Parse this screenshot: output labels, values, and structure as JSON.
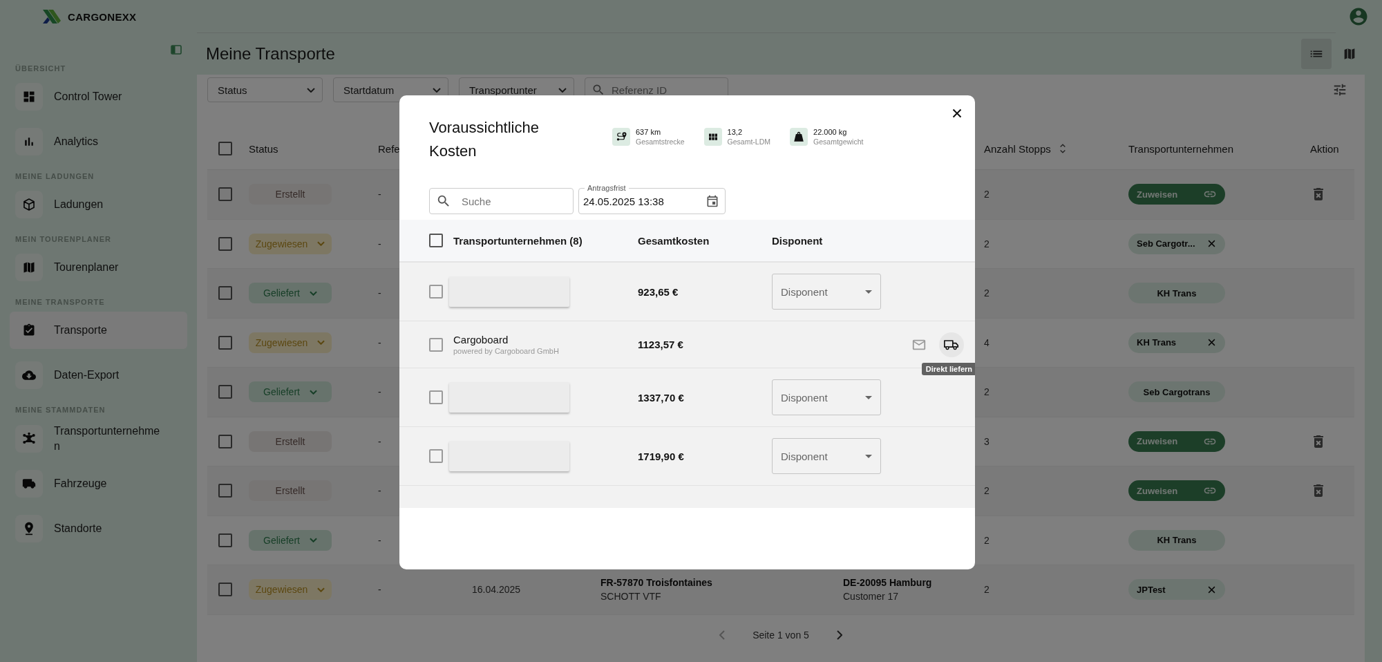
{
  "topbar": {
    "brand": "CARGONEXX"
  },
  "sidebar": {
    "sections": [
      {
        "heading": "ÜBERSICHT",
        "items": [
          {
            "label": "Control Tower",
            "selected": false
          },
          {
            "label": "Analytics",
            "selected": false
          }
        ]
      },
      {
        "heading": "MEINE LADUNGEN",
        "items": [
          {
            "label": "Ladungen",
            "selected": false
          }
        ]
      },
      {
        "heading": "MEIN TOURENPLANER",
        "items": [
          {
            "label": "Tourenplaner",
            "selected": false
          }
        ]
      },
      {
        "heading": "MEINE TRANSPORTE",
        "items": [
          {
            "label": "Transporte",
            "selected": true
          },
          {
            "label": "Daten-Export",
            "selected": false
          }
        ]
      },
      {
        "heading": "MEINE STAMMDATEN",
        "items": [
          {
            "label": "Transportunternehmen",
            "selected": false
          },
          {
            "label": "Fahrzeuge",
            "selected": false
          },
          {
            "label": "Standorte",
            "selected": false
          }
        ]
      }
    ]
  },
  "page": {
    "title": "Meine Transporte",
    "views": [
      {
        "selected": true
      },
      {
        "selected": false
      }
    ]
  },
  "filters": [
    {
      "kind": "select",
      "label": "Status"
    },
    {
      "kind": "select",
      "label": "Startdatum"
    },
    {
      "kind": "select",
      "label": "Transportunter"
    },
    {
      "kind": "search",
      "placeholder": "Referenz ID"
    }
  ],
  "table": {
    "all_selected": false,
    "columns": [
      {
        "label": "Status"
      },
      {
        "label": "Refe"
      },
      {
        "label": "Anzahl Stopps",
        "sortable": true
      },
      {
        "label": "Transportunternehmen"
      },
      {
        "label": "Aktion"
      }
    ],
    "rows": [
      {
        "selected": false,
        "status": {
          "kind": "created",
          "label": "Erstellt"
        },
        "reference": "-",
        "stops": "2",
        "carrier": {
          "kind": "assign",
          "label": "Zuweisen"
        },
        "deletable": true
      },
      {
        "selected": false,
        "status": {
          "kind": "assigned",
          "label": "Zugewiesen"
        },
        "reference": "-",
        "stops": "2",
        "carrier": {
          "kind": "removable",
          "label": "Seb Cargotr..."
        },
        "deletable": false
      },
      {
        "selected": false,
        "status": {
          "kind": "delivered",
          "label": "Geliefert"
        },
        "reference": "-",
        "stops": "2",
        "carrier": {
          "kind": "fixed",
          "label": "KH Trans"
        },
        "deletable": false
      },
      {
        "selected": false,
        "status": {
          "kind": "assigned",
          "label": "Zugewiesen"
        },
        "reference": "-",
        "stops": "4",
        "carrier": {
          "kind": "removable",
          "label": "KH Trans"
        },
        "deletable": false
      },
      {
        "selected": false,
        "status": {
          "kind": "delivered",
          "label": "Geliefert"
        },
        "reference": "-",
        "stops": "2",
        "carrier": {
          "kind": "fixed",
          "label": "Seb Cargotrans"
        },
        "deletable": false
      },
      {
        "selected": false,
        "status": {
          "kind": "created",
          "label": "Erstellt"
        },
        "reference": "-",
        "stops": "3",
        "carrier": {
          "kind": "assign",
          "label": "Zuweisen"
        },
        "deletable": true
      },
      {
        "selected": false,
        "status": {
          "kind": "created",
          "label": "Erstellt"
        },
        "reference": "-",
        "stops": "2",
        "carrier": {
          "kind": "assign",
          "label": "Zuweisen"
        },
        "deletable": true
      },
      {
        "selected": false,
        "status": {
          "kind": "delivered",
          "label": "Geliefert"
        },
        "reference": "-",
        "stops": "2",
        "carrier": {
          "kind": "fixed",
          "label": "KH Trans"
        },
        "deletable": false
      },
      {
        "selected": false,
        "status": {
          "kind": "assigned",
          "label": "Zugewiesen"
        },
        "reference": "-",
        "start_date": "16.04.2025",
        "from": {
          "place": "FR-57870 Troisfontaines",
          "name": "SCHOTT VTF"
        },
        "to": {
          "place": "DE-20095 Hamburg",
          "name": "Customer 17"
        },
        "stops": "2",
        "carrier": {
          "kind": "removable",
          "label": "JPTest"
        },
        "deletable": false
      }
    ]
  },
  "pagination": {
    "label": "Seite 1 von 5",
    "prev_disabled": true,
    "next_disabled": false
  },
  "modal": {
    "title": "Voraussichtliche Kosten",
    "stats": [
      {
        "value": "637 km",
        "label": "Gesamtstrecke"
      },
      {
        "value": "13,2",
        "label": "Gesamt-LDM"
      },
      {
        "value": "22.000 kg",
        "label": "Gesamtgewicht"
      }
    ],
    "search": {
      "placeholder": "Suche"
    },
    "deadline": {
      "label": "Antragsfrist",
      "value": "24.05.2025 13:38"
    },
    "all_selected": false,
    "columns": [
      "Transportunternehmen (8)",
      "Gesamtkosten",
      "Disponent"
    ],
    "rows": [
      {
        "kind": "dropdown",
        "selected": false,
        "cost": "923,65 €",
        "dispatcher_placeholder": "Disponent"
      },
      {
        "kind": "direct",
        "selected": false,
        "name": "Cargoboard",
        "subtitle": "powered by Cargoboard GmbH",
        "cost": "1123,57 €",
        "tooltip": "Direkt liefern"
      },
      {
        "kind": "dropdown",
        "selected": false,
        "cost": "1337,70 €",
        "dispatcher_placeholder": "Disponent"
      },
      {
        "kind": "dropdown",
        "selected": false,
        "cost": "1719,90 €",
        "dispatcher_placeholder": "Disponent"
      }
    ]
  }
}
